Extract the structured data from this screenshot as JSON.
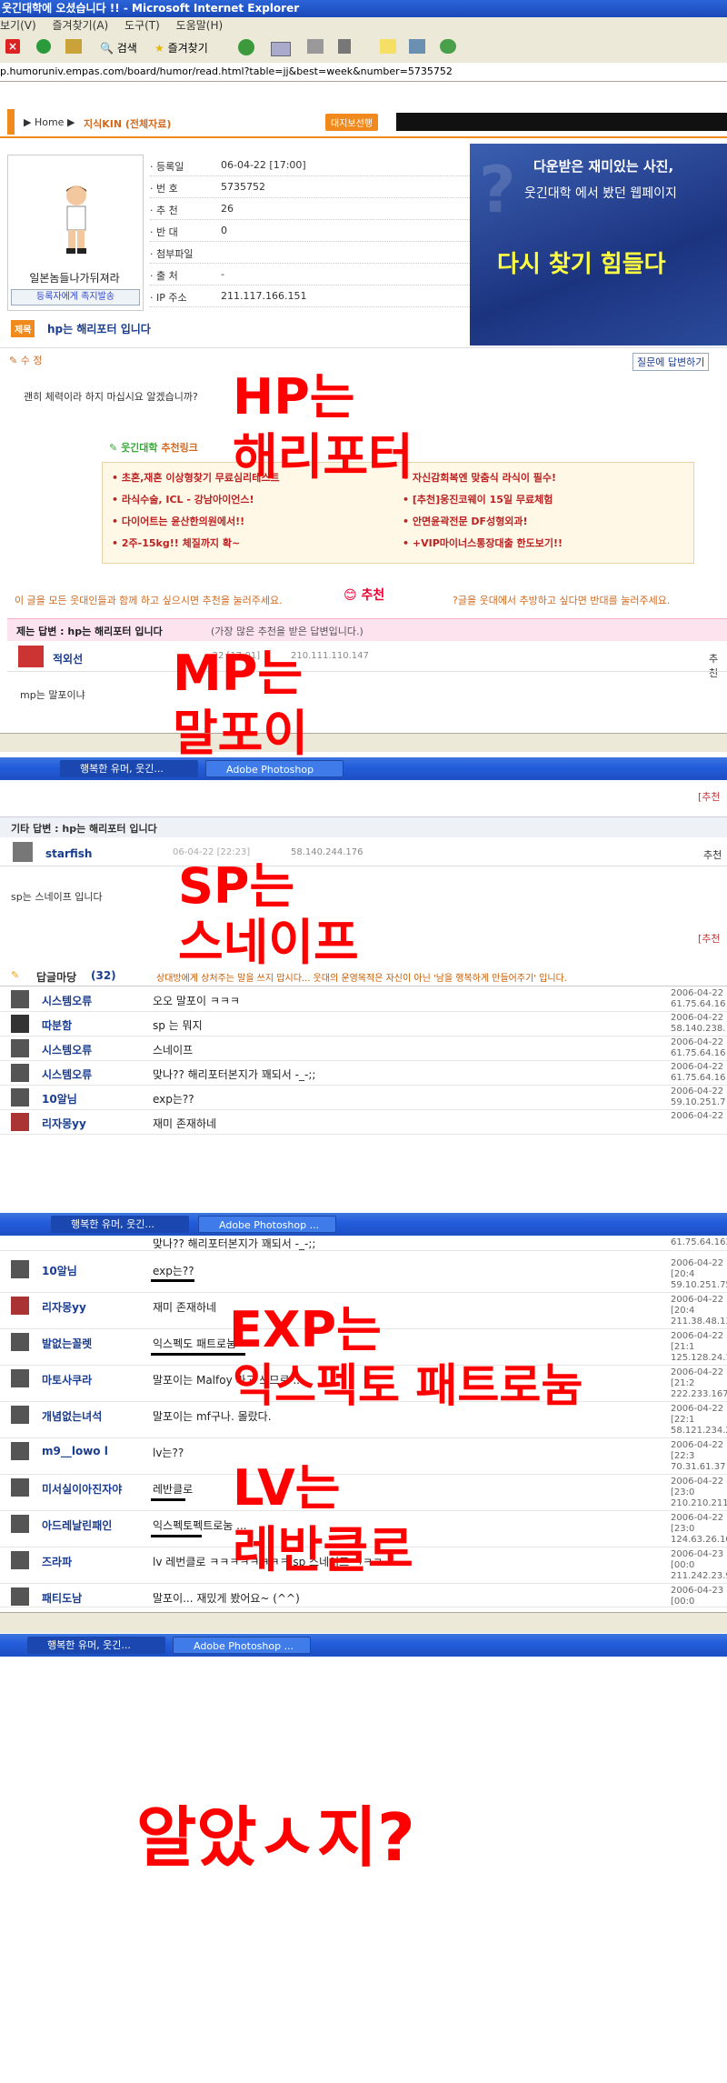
{
  "window": {
    "title": "웃긴대학에 오셨습니다 !! - Microsoft Internet Explorer"
  },
  "menu": [
    "보기(V)",
    "즐겨찾기(A)",
    "도구(T)",
    "도움말(H)"
  ],
  "toolbar": {
    "search": "검색",
    "favorites": "즐겨찾기"
  },
  "address": "p.humoruniv.empas.com/board/humor/read.html?table=jj&best=week&number=5735752",
  "breadcrumb": {
    "home": "Home",
    "section": "지식KIN (전체자료)",
    "badge": "대지보선행"
  },
  "post": {
    "labels": [
      "· 등록일",
      "· 번 호",
      "· 추 천",
      "· 반 대",
      "· 첨부파일",
      "· 출 처",
      "· IP 주소"
    ],
    "values": [
      "06-04-22 [17:00]",
      "5735752",
      "26",
      "0",
      "",
      "-",
      "211.117.166.151"
    ],
    "author": "일본놈들나가뒤져라",
    "msg_button": "등록자에게 족지발송",
    "title_tag": "제목",
    "title": "hp는 해리포터 입니다",
    "edit": "수 정",
    "reply_link": "질문에 답변하기",
    "body": "괜히 체력이라 하지 마십시요 알겠습니까?"
  },
  "banner": {
    "line1": "다운받은 재미있는 사진,",
    "line2": "웃긴대학 에서 봤던 웹페이지",
    "line3": "다시 찾기 힘들다"
  },
  "recommend": {
    "brand": "웃긴대학",
    "label": "추천링크",
    "links": [
      "초혼,재혼 이상형찾기 무료심리테스트",
      "자신감회복엔 맞춤식 라식이 필수!",
      "라식수술, ICL - 강남아이언스!",
      "[추천]웅진코웨이 15일 무료체험",
      "다이어트는 윤산한의원에서!!",
      "안면윤곽전문 DF성형외과!",
      "2주-15kg!! 체질까지 확~",
      "+VIP마이너스통장대출 한도보기!!"
    ]
  },
  "recommend_bar": {
    "left": "이 글을 모든 웃대인들과 함께 하고 싶으시면 추천을 눌러주세요.",
    "btn": "추천",
    "right": "?글을 웃대에서 추방하고 싶다면 반대를 눌러주세요."
  },
  "best_answer": {
    "header": "제는 답변 : hp는 해리포터 입니다",
    "header_note": "(가장 많은 추천을 받은 답변입니다.)",
    "author": "적외선",
    "date": "-22 [17:01]",
    "ip": "210.111.110.147",
    "recommend": "추천",
    "body": "mp는 말포이냐"
  },
  "taskbar1": {
    "t1": "행복한 유머, 웃긴...",
    "t2": "Adobe Photoshop"
  },
  "other_answer": {
    "top_link": "[추천",
    "header": "기타 답변 : hp는 해리포터 입니다",
    "author": "starfish",
    "date": "06-04-22 [22:23]",
    "ip": "58.140.244.176",
    "recommend": "추천",
    "body": "sp는 스네이프 입니다",
    "bottom_link": "[추천"
  },
  "comments_header": {
    "title": "답글마당",
    "count": "(32)",
    "note": "상대방에게 상처주는 말을 쓰지 맙시다... 웃대의 운영목적은 자신이 아닌 '남을 행복하게 만들어주기' 입니다."
  },
  "comments1": [
    {
      "nick": "시스템오류",
      "msg": "오오 말포이 ㅋㅋㅋ",
      "date": "2006-04-22",
      "ip": "61.75.64.16"
    },
    {
      "nick": "따분함",
      "msg": "sp 는 뭐지",
      "date": "2006-04-22",
      "ip": "58.140.238."
    },
    {
      "nick": "시스템오류",
      "msg": "스네이프",
      "date": "2006-04-22",
      "ip": "61.75.64.16"
    },
    {
      "nick": "시스템오류",
      "msg": "맞나?? 해리포터본지가 꽤되서 -_-;;",
      "date": "2006-04-22",
      "ip": "61.75.64.16"
    },
    {
      "nick": "10알님",
      "msg": "exp는??",
      "date": "2006-04-22",
      "ip": "59.10.251.7"
    },
    {
      "nick": "리자몽yy",
      "msg": "재미 존재하네",
      "date": "2006-04-22",
      "ip": ""
    }
  ],
  "taskbar2": {
    "t1": "행복한 유머, 웃긴...",
    "t2": "Adobe Photoshop ..."
  },
  "comments2_cut": {
    "msg": "맞나?? 해리포터본지가 꽤되서 -_-;;",
    "ip": "61.75.64.163"
  },
  "comments2": [
    {
      "nick": "10알님",
      "msg": "exp는??",
      "date": "2006-04-22 [20:4",
      "ip": "59.10.251.75"
    },
    {
      "nick": "리자몽yy",
      "msg": "재미 존재하네",
      "date": "2006-04-22 [20:4",
      "ip": "211.38.48.131"
    },
    {
      "nick": "발없는꼴렛",
      "msg": "익스펙도 패트로눔",
      "date": "2006-04-22 [21:1",
      "ip": "125.128.24.14"
    },
    {
      "nick": "마토사쿠라",
      "msg": "말포이는 Malfoy 라고 쓰므로 ...",
      "date": "2006-04-22 [21:2",
      "ip": "222.233.167.192"
    },
    {
      "nick": "개념없는녀석",
      "msg": "말포이는 mf구나. 몰랐다.",
      "date": "2006-04-22 [22:1",
      "ip": "58.121.234.2"
    },
    {
      "nick": "m9__lowo l",
      "msg": "lv는??",
      "date": "2006-04-22 [22:3",
      "ip": "70.31.61.37"
    },
    {
      "nick": "미서실이아진자야",
      "msg": "레반클로",
      "date": "2006-04-22 [23:0",
      "ip": "210.210.211.78"
    },
    {
      "nick": "아드레날린패인",
      "msg": "익스펙토펙트로눔 ...",
      "date": "2006-04-22 [23:0",
      "ip": "124.63.26.106"
    },
    {
      "nick": "즈라파",
      "msg": "lv 레번클로 ㅋㅋㅋㅋㅋㅋㅋㅋ sp 스네이프 ㅋㅋㅋ",
      "date": "2006-04-23 [00:0",
      "ip": "211.242.23.91"
    },
    {
      "nick": "패티도남",
      "msg": "말포이... 재밌게 봤어요~ (^^)",
      "date": "2006-04-23 [00:0",
      "ip": ""
    }
  ],
  "taskbar3": {
    "t1": "행복한 유머, 웃긴...",
    "t2": "Adobe Photoshop ..."
  },
  "annotations": {
    "hp1": "HP는",
    "hp2": "해리포터",
    "mp1": "MP는",
    "mp2": "말포이",
    "sp1": "SP는",
    "sp2": "스네이프",
    "exp1": "EXP는",
    "exp2": "익스펙토 패트로눔",
    "lv1": "LV는",
    "lv2": "레반클로",
    "final": "알았ㅅ지?"
  }
}
